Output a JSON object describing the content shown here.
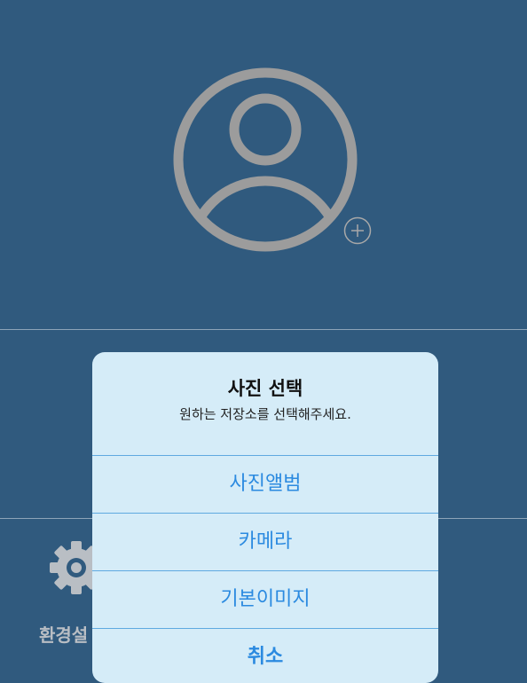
{
  "colors": {
    "background": "#305a7e",
    "avatar_gray": "#9c9c9c",
    "sheet_bg": "#d5ecf8",
    "action_blue": "#2b8ae0",
    "divider": "#5fa9e0"
  },
  "profile": {
    "avatar_icon": "user-circle-icon",
    "add_icon": "plus-circle-icon"
  },
  "settings": {
    "icon": "gear-icon",
    "label": "환경설"
  },
  "action_sheet": {
    "title": "사진 선택",
    "message": "원하는 저장소를 선택해주세요.",
    "options": [
      {
        "label": "사진앨범"
      },
      {
        "label": "카메라"
      },
      {
        "label": "기본이미지"
      }
    ],
    "cancel_label": "취소"
  }
}
